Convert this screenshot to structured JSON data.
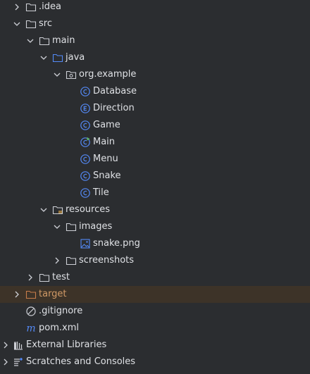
{
  "colors": {
    "background": "#2b2d30",
    "text": "#dfe1e5",
    "excluded_text": "#d19a66",
    "highlight_row": "#3d3328",
    "folder_stroke": "#ced0d6",
    "source_folder_stroke": "#548af7",
    "class_icon": "#548af7",
    "excluded_folder_stroke": "#c77d4a"
  },
  "tree": {
    "items": [
      {
        "label": ".idea"
      },
      {
        "label": "src"
      },
      {
        "label": "main"
      },
      {
        "label": "java"
      },
      {
        "label": "org.example"
      },
      {
        "label": "Database"
      },
      {
        "label": "Direction"
      },
      {
        "label": "Game"
      },
      {
        "label": "Main"
      },
      {
        "label": "Menu"
      },
      {
        "label": "Snake"
      },
      {
        "label": "Tile"
      },
      {
        "label": "resources"
      },
      {
        "label": "images"
      },
      {
        "label": "snake.png"
      },
      {
        "label": "screenshots"
      },
      {
        "label": "test"
      },
      {
        "label": "target"
      },
      {
        "label": ".gitignore"
      },
      {
        "label": "pom.xml"
      },
      {
        "label": "External Libraries"
      },
      {
        "label": "Scratches and Consoles"
      }
    ]
  }
}
